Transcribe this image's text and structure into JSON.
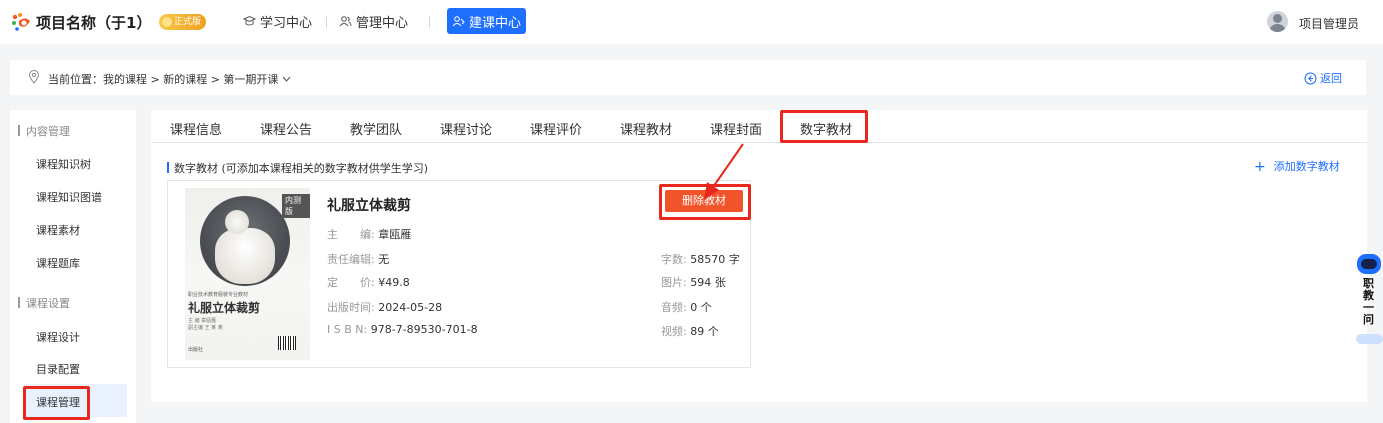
{
  "header": {
    "app_title": "项目名称（于1）",
    "badge": "正式版",
    "nav": [
      {
        "label": "学习中心",
        "icon": "graduation-cap-icon"
      },
      {
        "label": "管理中心",
        "icon": "users-icon"
      },
      {
        "label": "建课中心",
        "icon": "build-icon",
        "active": true
      }
    ],
    "user_name": "项目管理员"
  },
  "breadcrumb": {
    "text": "当前位置：我的课程 > 新的课程 > 第一期开课",
    "back_label": "返回"
  },
  "sidebar": {
    "groups": [
      {
        "title": "内容管理",
        "items": [
          "课程知识树",
          "课程知识图谱",
          "课程素材",
          "课程题库"
        ]
      },
      {
        "title": "课程设置",
        "items": [
          "课程设计",
          "目录配置",
          "课程管理"
        ]
      }
    ],
    "active_item": "课程管理"
  },
  "tabs": [
    "课程信息",
    "课程公告",
    "教学团队",
    "课程讨论",
    "课程评价",
    "课程教材",
    "课程封面",
    "数字教材"
  ],
  "active_tab": "数字教材",
  "section": {
    "title": "数字教材 (可添加本课程相关的数字教材供学生学习)",
    "add_label": "添加数字教材"
  },
  "book": {
    "title": "礼服立体裁剪",
    "cover": {
      "tag": "内测版",
      "series": "职业技术教育服装专业教材",
      "title": "礼服立体裁剪",
      "authors": "主 编 章瓯雁\n副主编 王 某 某",
      "publisher": "出版社"
    },
    "editor_label": "主　　编:",
    "editor": "章瓯雁",
    "resp_editor_label": "责任编辑:",
    "resp_editor": "无",
    "price_label": "定　　价:",
    "price": "¥49.8",
    "pub_date_label": "出版时间:",
    "pub_date": "2024-05-28",
    "isbn_label": "I S B N:",
    "isbn": "978-7-89530-701-8",
    "words_label": "字数:",
    "words": "58570 字",
    "images_label": "图片:",
    "images": "594 张",
    "audio_label": "音频:",
    "audio": "0 个",
    "video_label": "视频:",
    "video": "89 个",
    "delete_label": "删除教材"
  },
  "assistant": {
    "label": "职教一问"
  },
  "colors": {
    "primary": "#1f6fff",
    "danger": "#f1542a",
    "highlight_box": "#e8281c"
  }
}
